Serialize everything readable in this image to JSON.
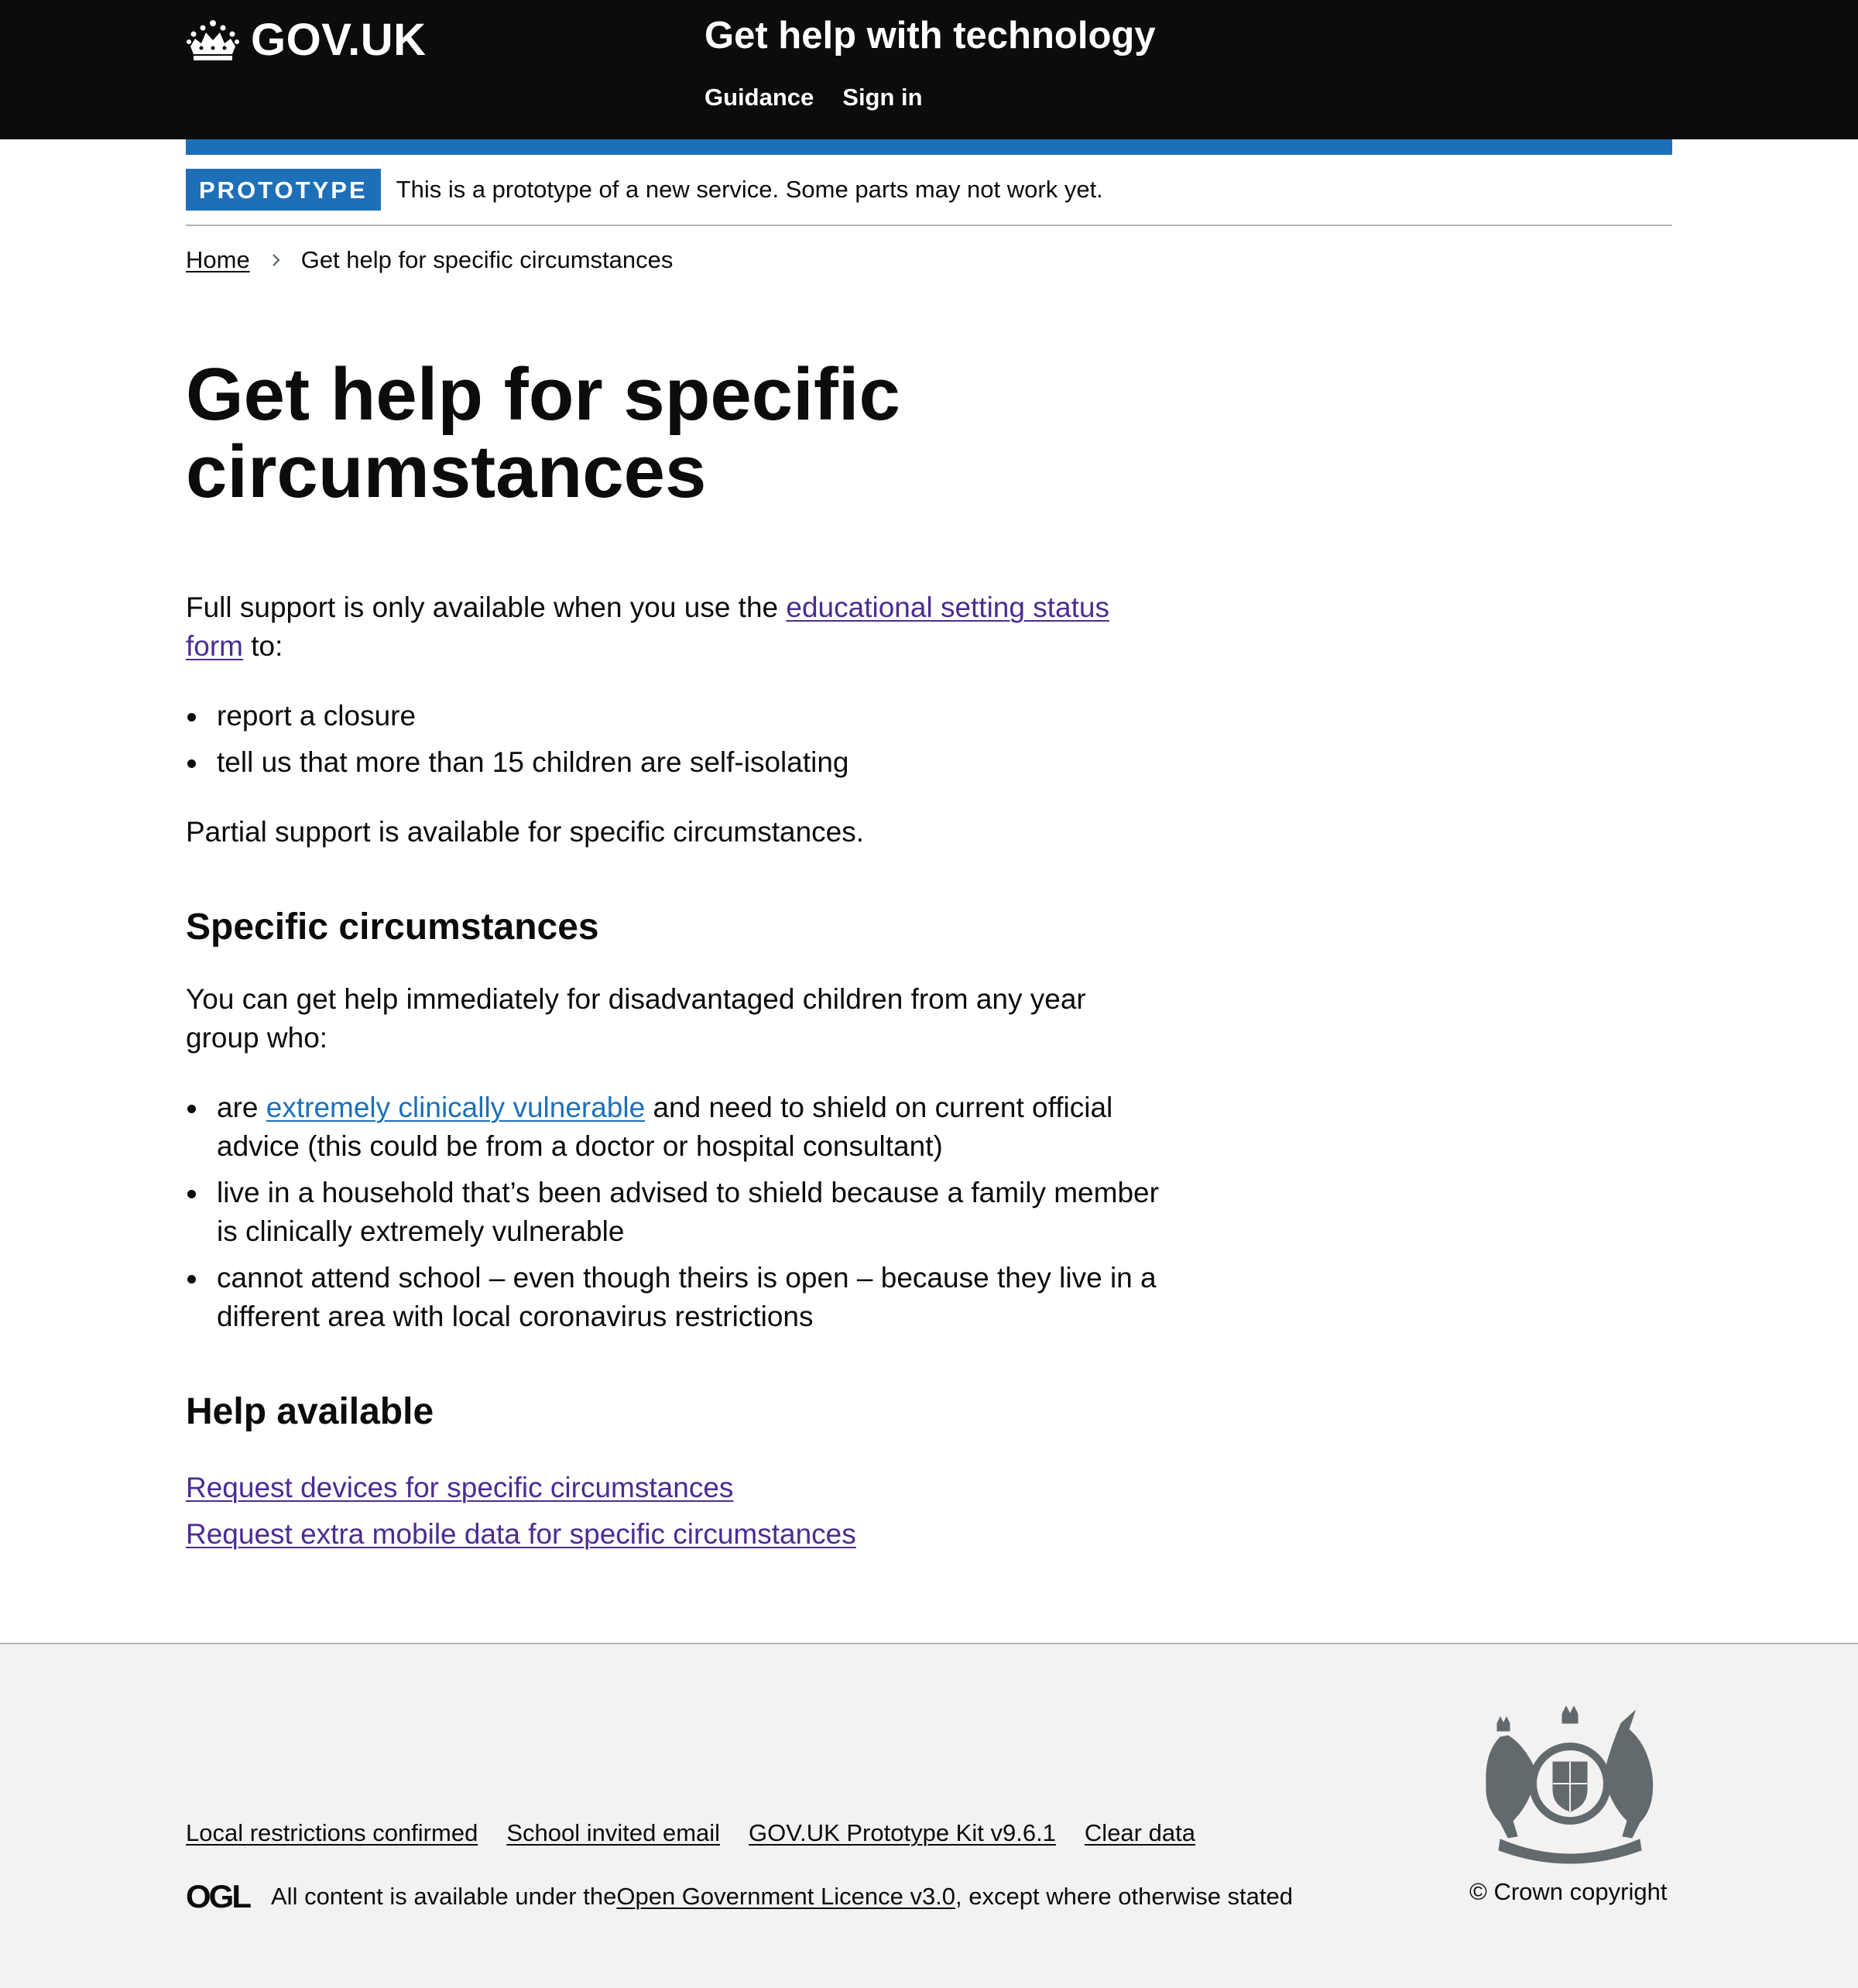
{
  "header": {
    "logo_text": "GOV.UK",
    "service_name": "Get help with technology",
    "nav": [
      {
        "label": "Guidance"
      },
      {
        "label": "Sign in"
      }
    ]
  },
  "phase_banner": {
    "tag": "PROTOTYPE",
    "text": "This is a prototype of a new service. Some parts may not work yet."
  },
  "breadcrumbs": {
    "home": "Home",
    "current": "Get help for specific circumstances"
  },
  "main": {
    "title": "Get help for specific circumstances",
    "intro_before_link": "Full support is only available when you use the ",
    "intro_link": "educational setting status form",
    "intro_after_link": " to:",
    "full_support_items": [
      "report a closure",
      "tell us that more than 15 children are self-isolating"
    ],
    "partial_support": "Partial support is available for specific circumstances.",
    "specific_heading": "Specific circumstances",
    "specific_intro": "You can get help immediately for disadvantaged children from any year group who:",
    "specific_item1_before": "are ",
    "specific_item1_link": "extremely clinically vulnerable",
    "specific_item1_after": " and need to shield on current official advice (this could be from a doctor or hospital consultant)",
    "specific_item2": "live in a household that’s been advised to shield because a family member is clinically extremely vulnerable",
    "specific_item3": "cannot attend school – even though theirs is open – because they live in a different area with local coronavirus restrictions",
    "help_heading": "Help available",
    "help_links": [
      "Request devices for specific circumstances",
      "Request extra mobile data for specific circumstances"
    ]
  },
  "footer": {
    "links": [
      "Local restrictions confirmed",
      "School invited email",
      "GOV.UK Prototype Kit v9.6.1",
      "Clear data"
    ],
    "ogl_logo": "OGL",
    "licence_before": "All content is available under the ",
    "licence_link": "Open Government Licence v3.0",
    "licence_after": ", except where otherwise stated",
    "copyright": "© Crown copyright"
  },
  "colors": {
    "header_bg": "#0b0c0c",
    "brand_blue": "#1d70b8",
    "visited_link": "#4c2c92",
    "footer_bg": "#f3f2f1"
  }
}
